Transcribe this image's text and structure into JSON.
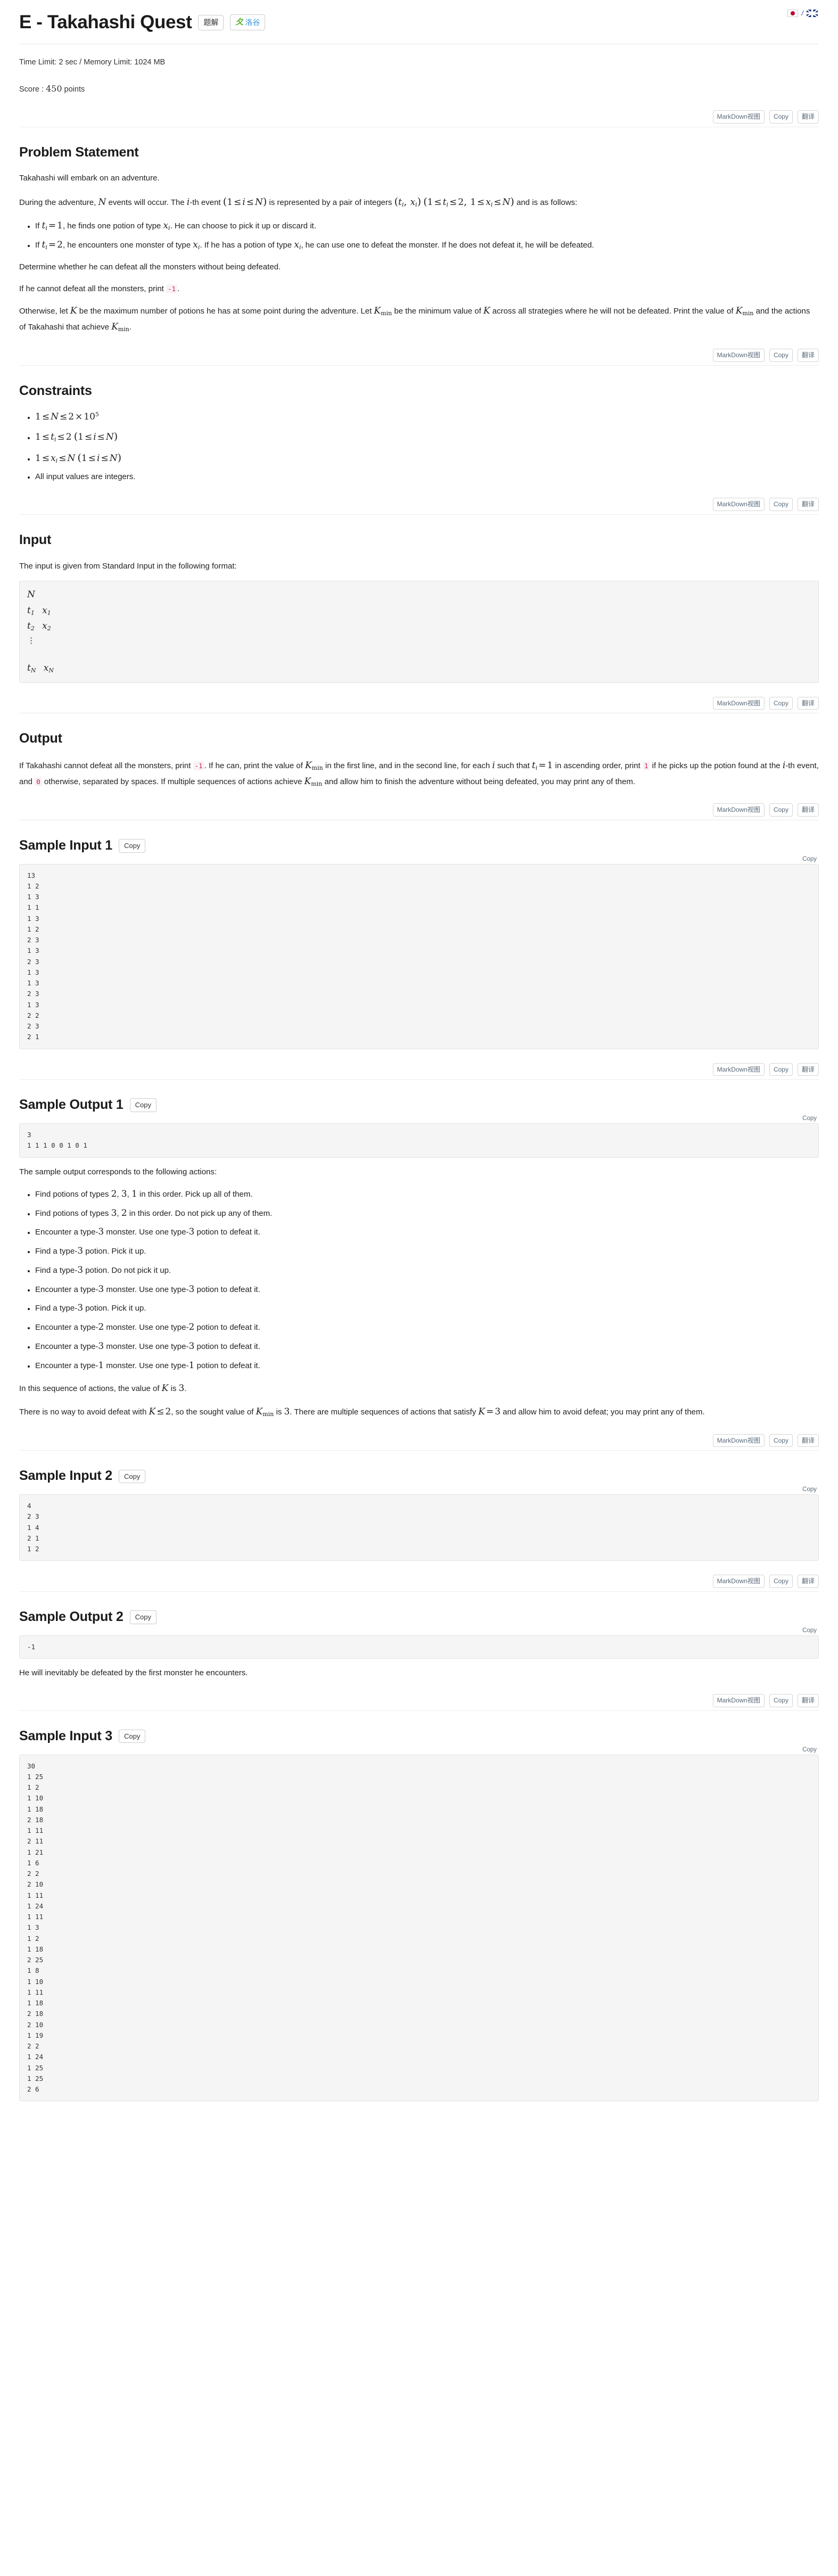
{
  "header": {
    "title": "E - Takahashi Quest",
    "editorial_button": "题解",
    "luogu_button": "洛谷",
    "luogu_mark": "夂",
    "lang_separator": "/",
    "lang_jp": "jp-flag-icon",
    "lang_en": "uk-flag-icon"
  },
  "meta": {
    "limits": "Time Limit: 2 sec / Memory Limit: 1024 MB",
    "score_label": "Score : ",
    "score_value": "450",
    "score_suffix": " points"
  },
  "toolbar": {
    "markdown": "MarkDown视图",
    "copy": "Copy",
    "translate": "翻译"
  },
  "sections": {
    "problem_statement": {
      "heading": "Problem Statement",
      "p1": "Takahashi will embark on an adventure.",
      "p2_a": "During the adventure, ",
      "p2_N": "N",
      "p2_b": " events will occur. The ",
      "p2_i": "i",
      "p2_c": "-th event ",
      "p2_range": "(1 ≤ i ≤ N)",
      "p2_d": " is represented by a pair of integers ",
      "p2_pair": "(t_i, x_i)",
      "p2_cond": "(1 ≤ t_i ≤ 2, 1 ≤ x_i ≤ N)",
      "p2_e": " and is as follows:",
      "bullet1_pre": "If ",
      "bullet1_math": "t_i = 1",
      "bullet1_mid": ", he finds one potion of type ",
      "bullet1_x": "x_i",
      "bullet1_post": ". He can choose to pick it up or discard it.",
      "bullet2_pre": "If ",
      "bullet2_math": "t_i = 2",
      "bullet2_mid": ", he encounters one monster of type ",
      "bullet2_x": "x_i",
      "bullet2_mid2": ". If he has a potion of type ",
      "bullet2_x2": "x_i",
      "bullet2_post": ", he can use one to defeat the monster. If he does not defeat it, he will be defeated.",
      "p3": "Determine whether he can defeat all the monsters without being defeated.",
      "p4_a": "If he cannot defeat all the monsters, print ",
      "p4_code": "-1",
      "p4_b": ".",
      "p5_a": "Otherwise, let ",
      "p5_K": "K",
      "p5_b": " be the maximum number of potions he has at some point during the adventure. Let ",
      "p5_Kmin": "K_min",
      "p5_c": " be the minimum value of ",
      "p5_K2": "K",
      "p5_d": " across all strategies where he will not be defeated. Print the value of ",
      "p5_Kmin2": "K_min",
      "p5_e": " and the actions of Takahashi that achieve ",
      "p5_Kmin3": "K_min",
      "p5_f": "."
    },
    "constraints": {
      "heading": "Constraints",
      "items": [
        "1 ≤ N ≤ 2 × 10^5",
        "1 ≤ t_i ≤ 2 (1 ≤ i ≤ N)",
        "1 ≤ x_i ≤ N (1 ≤ i ≤ N)",
        "All input values are integers."
      ]
    },
    "input": {
      "heading": "Input",
      "description": "The input is given from Standard Input in the following format:",
      "format_lines": [
        "N",
        "t_1  x_1",
        "t_2  x_2",
        "⋮",
        "t_N  x_N"
      ]
    },
    "output": {
      "heading": "Output",
      "a": "If Takahashi cannot defeat all the monsters, print ",
      "code_m1": "-1",
      "b": ". If he can, print the value of ",
      "Kmin": "K_min",
      "c": " in the first line, and in the second line, for each ",
      "i": "i",
      "d": " such that ",
      "ti1": "t_i = 1",
      "e": " in ascending order, print ",
      "code_1": "1",
      "f": " if he picks up the potion found at the ",
      "i2": "i",
      "g": "-th event, and ",
      "code_0": "0",
      "h": " otherwise, separated by spaces. If multiple sequences of actions achieve ",
      "Kmin2": "K_min",
      "j": " and allow him to finish the adventure without being defeated, you may print any of them."
    }
  },
  "samples": [
    {
      "id": "sample-input-1",
      "heading": "Sample Input 1",
      "copy": "Copy",
      "content": "13\n1 2\n1 3\n1 1\n1 3\n1 2\n2 3\n1 3\n2 3\n1 3\n1 3\n2 3\n1 3\n2 2\n2 3\n2 1"
    },
    {
      "id": "sample-output-1",
      "heading": "Sample Output 1",
      "copy": "Copy",
      "content": "3\n1 1 1 0 0 1 0 1"
    },
    {
      "id": "sample-input-2",
      "heading": "Sample Input 2",
      "copy": "Copy",
      "content": "4\n2 3\n1 4\n2 1\n1 2"
    },
    {
      "id": "sample-output-2",
      "heading": "Sample Output 2",
      "copy": "Copy",
      "content": "-1"
    },
    {
      "id": "sample-input-3",
      "heading": "Sample Input 3",
      "copy": "Copy",
      "content": "30\n1 25\n1 2\n1 10\n1 18\n2 18\n1 11\n2 11\n1 21\n1 6\n2 2\n2 10\n1 11\n1 24\n1 11\n1 3\n1 2\n1 18\n2 25\n1 8\n1 10\n1 11\n1 18\n2 18\n2 10\n1 19\n2 2\n1 24\n1 25\n1 25\n2 6"
    }
  ],
  "explanation1": {
    "intro": "The sample output corresponds to the following actions:",
    "actions": [
      "Find potions of types 2, 3, 1 in this order. Pick up all of them.",
      "Find potions of types 3, 2 in this order. Do not pick up any of them.",
      "Encounter a type-3 monster. Use one type-3 potion to defeat it.",
      "Find a type-3 potion. Pick it up.",
      "Find a type-3 potion. Do not pick it up.",
      "Encounter a type-3 monster. Use one type-3 potion to defeat it.",
      "Find a type-3 potion. Pick it up.",
      "Encounter a type-2 monster. Use one type-2 potion to defeat it.",
      "Encounter a type-3 monster. Use one type-3 potion to defeat it.",
      "Encounter a type-1 monster. Use one type-1 potion to defeat it."
    ],
    "p_k_a": "In this sequence of actions, the value of ",
    "p_k_K": "K",
    "p_k_b": " is ",
    "p_k_v": "3",
    "p_k_c": ".",
    "p_final_a": "There is no way to avoid defeat with ",
    "p_final_cond": "K ≤ 2",
    "p_final_b": ", so the sought value of ",
    "p_final_Kmin": "K_min",
    "p_final_c": " is ",
    "p_final_v": "3",
    "p_final_d": ". There are multiple sequences of actions that satisfy ",
    "p_final_K3": "K = 3",
    "p_final_e": " and allow him to avoid defeat; you may print any of them."
  },
  "explanation2": {
    "text": "He will inevitably be defeated by the first monster he encounters."
  }
}
